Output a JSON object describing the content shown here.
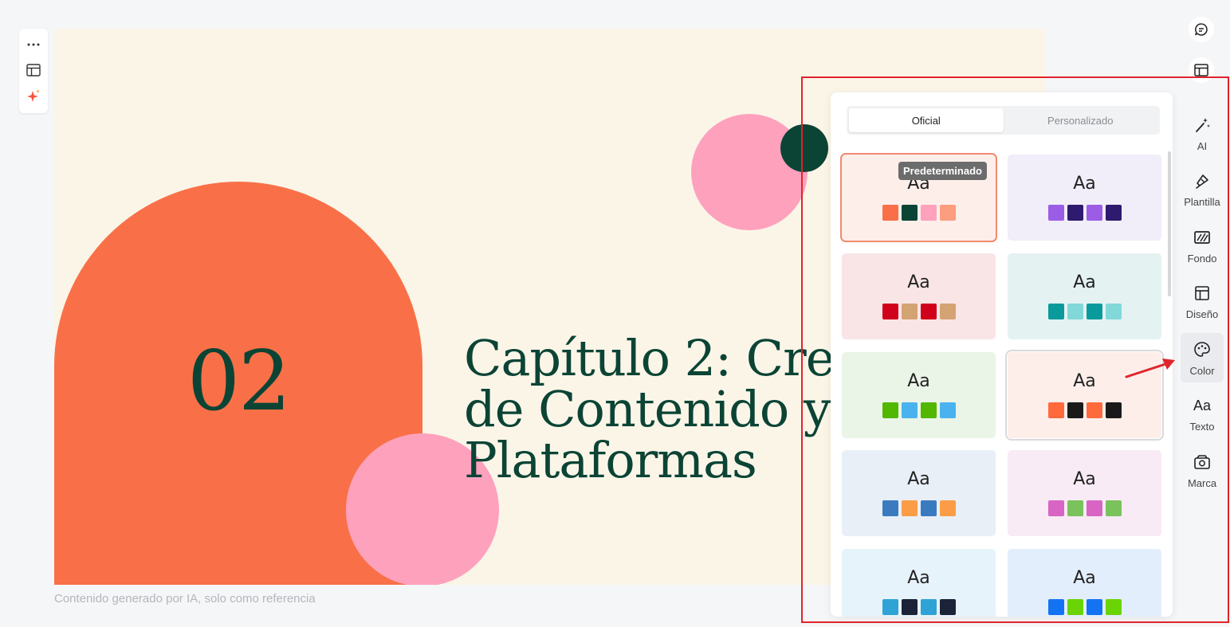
{
  "left_toolbar": {
    "more_icon": "more-horizontal-icon",
    "layout_icon": "layout-icon",
    "ai_sparkle_icon": "sparkle-icon"
  },
  "slide": {
    "number": "02",
    "title_lines": [
      "Capítulo 2: Cre",
      "de Contenido y",
      "Plataformas"
    ],
    "colors": {
      "background": "#fbf5e8",
      "arch": "#f97048",
      "pink": "#fea1bd",
      "green": "#0b4435"
    }
  },
  "caption": "Contenido generado por IA, solo como referencia",
  "top_icons": [
    "chat-icon",
    "layout-settings-icon"
  ],
  "panel": {
    "tabs": [
      "Oficial",
      "Personalizado"
    ],
    "active_tab": "Oficial",
    "tooltip": "Predeterminado",
    "themes": [
      {
        "label": "Aa",
        "bg": "#fdeeea",
        "swatches": [
          "#f97048",
          "#0b4435",
          "#fea1bd",
          "#fb9d7e"
        ]
      },
      {
        "label": "Aa",
        "bg": "#f1edf9",
        "swatches": [
          "#9b5de5",
          "#2e1a6e",
          "#9b5de5",
          "#2e1a6e"
        ]
      },
      {
        "label": "Aa",
        "bg": "#f9e5e6",
        "swatches": [
          "#d0021b",
          "#d4a373",
          "#d0021b",
          "#d4a373"
        ]
      },
      {
        "label": "Aa",
        "bg": "#e4f2f2",
        "swatches": [
          "#0b9a9c",
          "#82d8d8",
          "#0b9a9c",
          "#82d8d8"
        ]
      },
      {
        "label": "Aa",
        "bg": "#ebf5e7",
        "swatches": [
          "#52b700",
          "#4ab3ef",
          "#52b700",
          "#4ab3ef"
        ]
      },
      {
        "label": "Aa",
        "bg": "#fdeeea",
        "swatches": [
          "#ff6a3d",
          "#1a1a1a",
          "#ff6a3d",
          "#1a1a1a"
        ]
      },
      {
        "label": "Aa",
        "bg": "#e9eff6",
        "swatches": [
          "#3a7bbf",
          "#fb9d47",
          "#3a7bbf",
          "#fb9d47"
        ]
      },
      {
        "label": "Aa",
        "bg": "#f8ebf5",
        "swatches": [
          "#d864c4",
          "#7ac25b",
          "#d864c4",
          "#7ac25b"
        ]
      },
      {
        "label": "Aa",
        "bg": "#e7f3fb",
        "swatches": [
          "#2fa3d6",
          "#1c2237",
          "#2fa3d6",
          "#1c2237"
        ]
      },
      {
        "label": "Aa",
        "bg": "#e3eefc",
        "swatches": [
          "#1473f2",
          "#6bd404",
          "#1473f2",
          "#6bd404"
        ]
      }
    ]
  },
  "rail": {
    "items": [
      {
        "label": "AI",
        "icon": "magic-wand-icon"
      },
      {
        "label": "Plantilla",
        "icon": "template-icon"
      },
      {
        "label": "Fondo",
        "icon": "background-icon"
      },
      {
        "label": "Diseño",
        "icon": "design-layout-icon"
      },
      {
        "label": "Color",
        "icon": "palette-icon"
      },
      {
        "label": "Texto",
        "icon": "text-icon",
        "glyph": "Aa"
      },
      {
        "label": "Marca",
        "icon": "brand-icon"
      }
    ],
    "active": "Color"
  },
  "annotation_color": "#e0242b"
}
